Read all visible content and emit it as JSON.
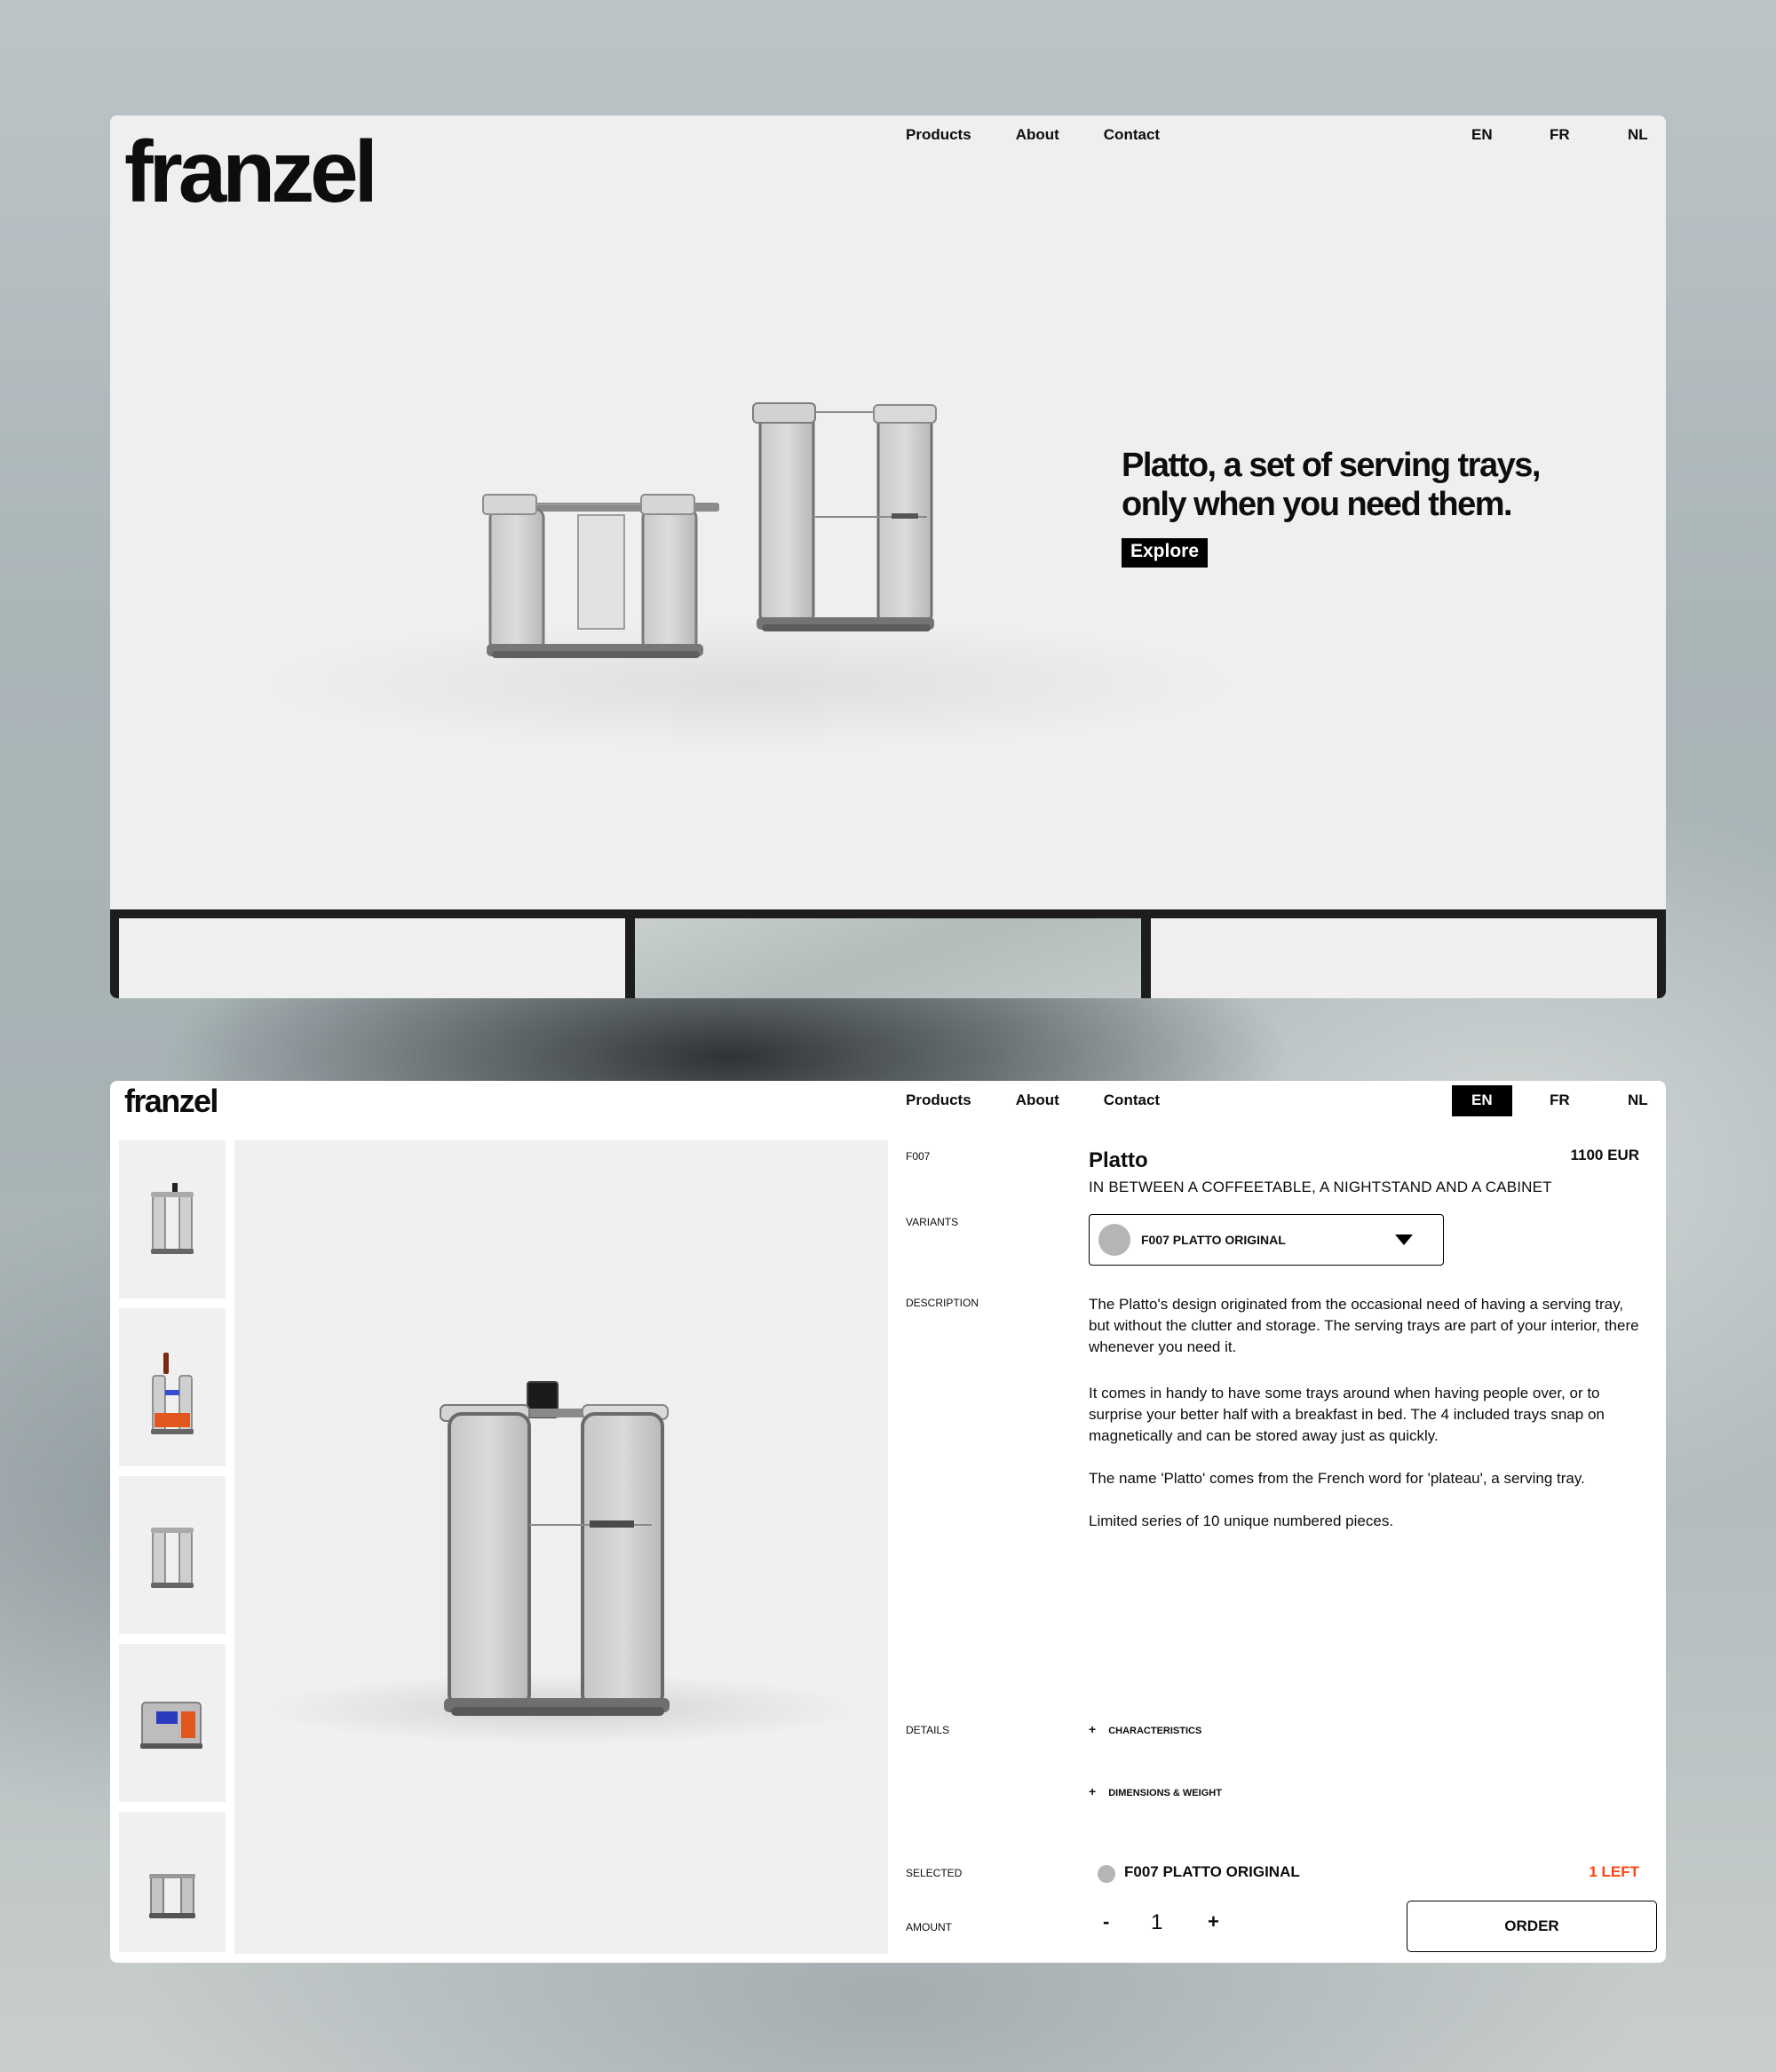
{
  "hero": {
    "logo": "franzel",
    "nav": [
      "Products",
      "About",
      "Contact"
    ],
    "languages": [
      "EN",
      "FR",
      "NL"
    ],
    "headline": "Platto, a set of serving trays, only when you need them.",
    "cta": "Explore"
  },
  "product": {
    "logo": "franzel",
    "nav": [
      "Products",
      "About",
      "Contact"
    ],
    "languages": [
      "EN",
      "FR",
      "NL"
    ],
    "active_language": "EN",
    "code": "F007",
    "name": "Platto",
    "price": "1100 EUR",
    "subtitle": "IN BETWEEN A COFFEETABLE, A NIGHTSTAND AND A CABINET",
    "labels": {
      "variants": "VARIANTS",
      "description": "DESCRIPTION",
      "details": "DETAILS",
      "selected": "SELECTED",
      "amount": "AMOUNT"
    },
    "variant_selected": "F007 PLATTO ORIGINAL",
    "variant_swatch_color": "#b5b5b5",
    "description": [
      "The Platto's design originated from the occasional need of having a serving tray, but without the clutter and storage. The serving trays are part of your interior, there whenever you need it.",
      "It comes in handy to have some trays around when having people over, or to surprise your better half with a breakfast in bed. The 4 included trays snap on magnetically and can be stored away just as quickly.",
      "The name 'Platto' comes from the French word for 'plateau', a serving tray.",
      "Limited series of 10 unique numbered pieces."
    ],
    "details": [
      "CHARACTERISTICS",
      "DIMENSIONS & WEIGHT"
    ],
    "details_toggle": "+",
    "selected_name": "F007 PLATTO ORIGINAL",
    "stock": "1 LEFT",
    "stock_color": "#ff4411",
    "amount": {
      "minus": "-",
      "value": "1",
      "plus": "+"
    },
    "order": "ORDER"
  }
}
